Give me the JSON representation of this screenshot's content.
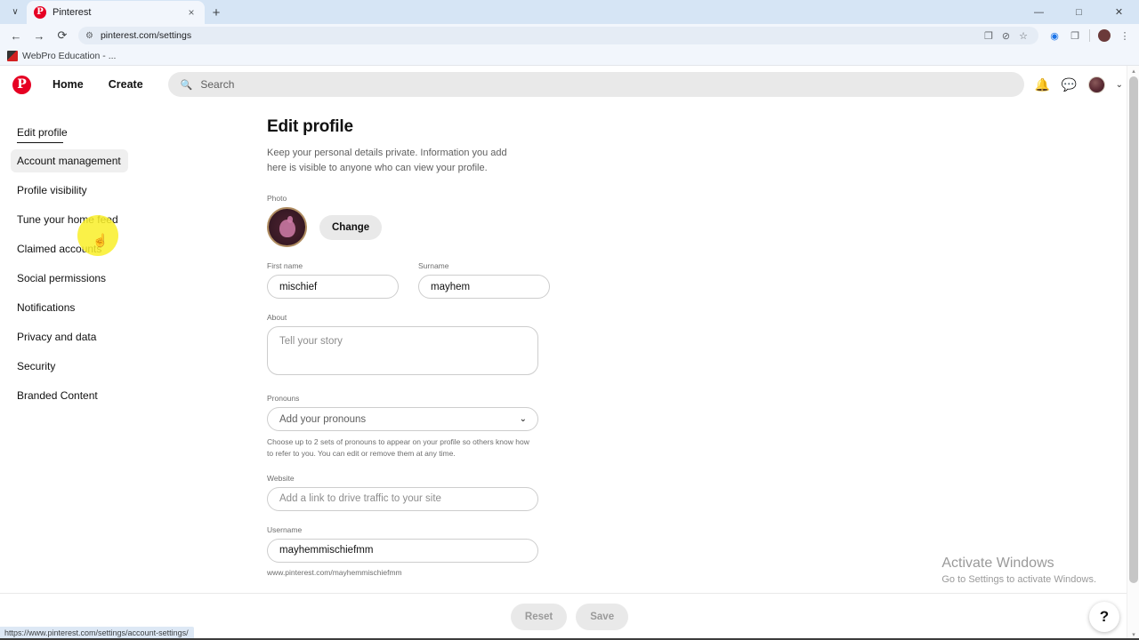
{
  "browser": {
    "tab": {
      "title": "Pinterest",
      "favicon": "pinterest-icon",
      "close": "×"
    },
    "newtab_label": "+",
    "tab_search_chevron": "∨",
    "window_controls": {
      "minimize": "—",
      "maximize": "□",
      "close": "✕"
    },
    "nav": {
      "back": "←",
      "forward": "→",
      "reload": "⟳"
    },
    "omnibox": {
      "url": "pinterest.com/settings",
      "site_settings_icon": "tune-icon"
    },
    "omnibox_actions": {
      "cast": "❐",
      "incognito_block": "⊘",
      "bookmark": "☆"
    },
    "toolbar_right": {
      "extension": "◉",
      "sidepanel": "❐",
      "profile": "avatar-icon",
      "menu": "⋮"
    },
    "bookmarks": [
      {
        "label": "WebPro Education - ..."
      }
    ],
    "status_link": "https://www.pinterest.com/settings/account-settings/"
  },
  "pinterest_header": {
    "logo": "P",
    "home_label": "Home",
    "create_label": "Create",
    "search_placeholder": "Search",
    "search_icon": "search-icon",
    "notifications_icon": "bell-icon",
    "messages_icon": "chat-icon",
    "avatar": "user-avatar",
    "chevron": "⌄"
  },
  "sidebar": {
    "items": [
      {
        "label": "Edit profile",
        "active": true
      },
      {
        "label": "Account management",
        "hovered": true
      },
      {
        "label": "Profile visibility"
      },
      {
        "label": "Tune your home feed"
      },
      {
        "label": "Claimed accounts"
      },
      {
        "label": "Social permissions"
      },
      {
        "label": "Notifications"
      },
      {
        "label": "Privacy and data"
      },
      {
        "label": "Security"
      },
      {
        "label": "Branded Content"
      }
    ]
  },
  "main": {
    "title": "Edit profile",
    "subtitle": "Keep your personal details private. Information you add here is visible to anyone who can view your profile.",
    "photo": {
      "label": "Photo",
      "change_button": "Change"
    },
    "first_name": {
      "label": "First name",
      "value": "mischief",
      "placeholder": "First name"
    },
    "surname": {
      "label": "Surname",
      "value": "mayhem",
      "placeholder": "Surname"
    },
    "about": {
      "label": "About",
      "value": "",
      "placeholder": "Tell your story"
    },
    "pronouns": {
      "label": "Pronouns",
      "selected": "Add your pronouns",
      "chevron": "⌄",
      "helper": "Choose up to 2 sets of pronouns to appear on your profile so others know how to refer to you. You can edit or remove them at any time."
    },
    "website": {
      "label": "Website",
      "value": "",
      "placeholder": "Add a link to drive traffic to your site"
    },
    "username": {
      "label": "Username",
      "value": "mayhemmischiefmm",
      "placeholder": "Username",
      "profile_url": "www.pinterest.com/mayhemmischiefmm"
    }
  },
  "bottom_bar": {
    "reset_label": "Reset",
    "save_label": "Save"
  },
  "help_fab": {
    "label": "?"
  },
  "watermark": {
    "line1": "Activate Windows",
    "line2": "Go to Settings to activate Windows."
  },
  "scrollbar": {
    "up": "▴",
    "down": "▾"
  },
  "colors": {
    "pinterest_red": "#e60023",
    "chrome_tabstrip": "#d6e5f5",
    "chrome_toolbar": "#f2f6fc",
    "highlight_yellow": "#f9ef28",
    "field_border": "#cdcdcd",
    "muted_text": "#6e6e6e"
  }
}
